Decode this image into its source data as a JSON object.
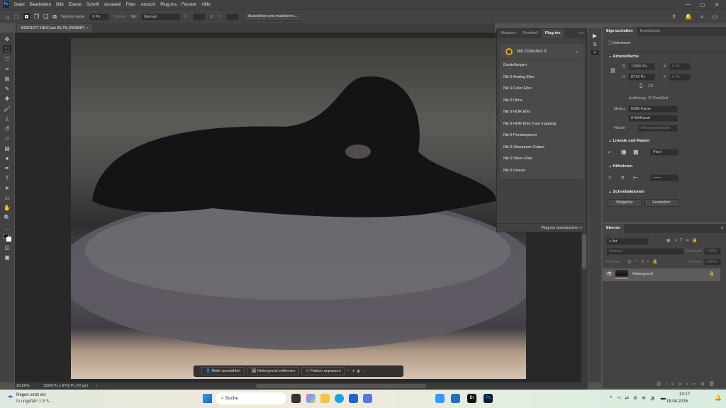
{
  "menu": {
    "items": [
      "Datei",
      "Bearbeiten",
      "Bild",
      "Ebene",
      "Schrift",
      "Auswahl",
      "Filter",
      "Ansicht",
      "Plug-ins",
      "Fenster",
      "Hilfe"
    ]
  },
  "options": {
    "feather_label": "Weiche Kante:",
    "feather_value": "0 Px",
    "antialias_label": "Glätten",
    "style_label": "Stil:",
    "style_value": "Normal",
    "width_label": "B:",
    "height_label": "H:",
    "select_mask_button": "Auswählen und maskieren..."
  },
  "document": {
    "tab_title": "B0001677.HEIC bei 20,7% (RGB/8*)",
    "zoom": "20,66%",
    "dimensions": "11656 Px x 8742 Px (72 ppi)"
  },
  "plugins_panel": {
    "tabs": [
      "Aktionen",
      "Protokoll",
      "Plug-ins"
    ],
    "active_tab": "Plug-ins",
    "collection": "Nik Collection 9",
    "items": [
      "Einstellungen",
      "Nik 9 Analog Efex",
      "Nik 9 Color Efex",
      "Nik 9 Dfine",
      "Nik 9 HDR Efex",
      "Nik 9 HDR Efex Tone mapping",
      "Nik 9 Presharpener",
      "Nik 9 Sharpener Output",
      "Nik 9 Silver Efex",
      "Nik 9 Viveza"
    ],
    "browse": "Plug-ins durchsuchen"
  },
  "properties": {
    "tabs": [
      "Eigenschaften",
      "Korrekturen"
    ],
    "type": "Dokument",
    "canvas_section": "Arbeitsfläche",
    "w_label": "B",
    "w_value": "11656 Px",
    "h_label": "H",
    "h_value": "8742 Px",
    "x_label": "X",
    "x_value": "0 Px",
    "y_label": "Y",
    "y_value": "0 Px",
    "resolution": "Auflösung: 72 Pixel/Zoll",
    "mode_label": "Modus",
    "mode_value": "RGB-Farbe",
    "depth_value": "8 Bit/Kanal",
    "fill_label": "Fläche",
    "fill_value": "Hintergrundfarbe",
    "rulers_section": "Lineale und Raster",
    "unit_value": "Pixel",
    "guides_section": "Hilfslinien",
    "quick_section": "Schnellaktionen",
    "image_size_button": "Bildgröße",
    "remove_bg_button": "Freistellen"
  },
  "layers": {
    "tab": "Ebenen",
    "filter_placeholder": "Art",
    "blend": "Normal",
    "opacity_label": "Deckkraft:",
    "opacity_value": "100%",
    "lock_label": "Fixieren:",
    "fill_label": "Fläche:",
    "fill_value": "100%",
    "layer_name": "Hintergrund"
  },
  "context_bar": {
    "select_subject": "Motiv auswählen",
    "remove_bg": "Hintergrund entfernen",
    "adjust_colors": "Farben anpassen"
  },
  "taskbar": {
    "weather_title": "Regen setzt ein",
    "weather_sub": "In ungefähr 1,5 S...",
    "search_placeholder": "Suche",
    "time": "13:17",
    "date": "18.04.2026"
  }
}
